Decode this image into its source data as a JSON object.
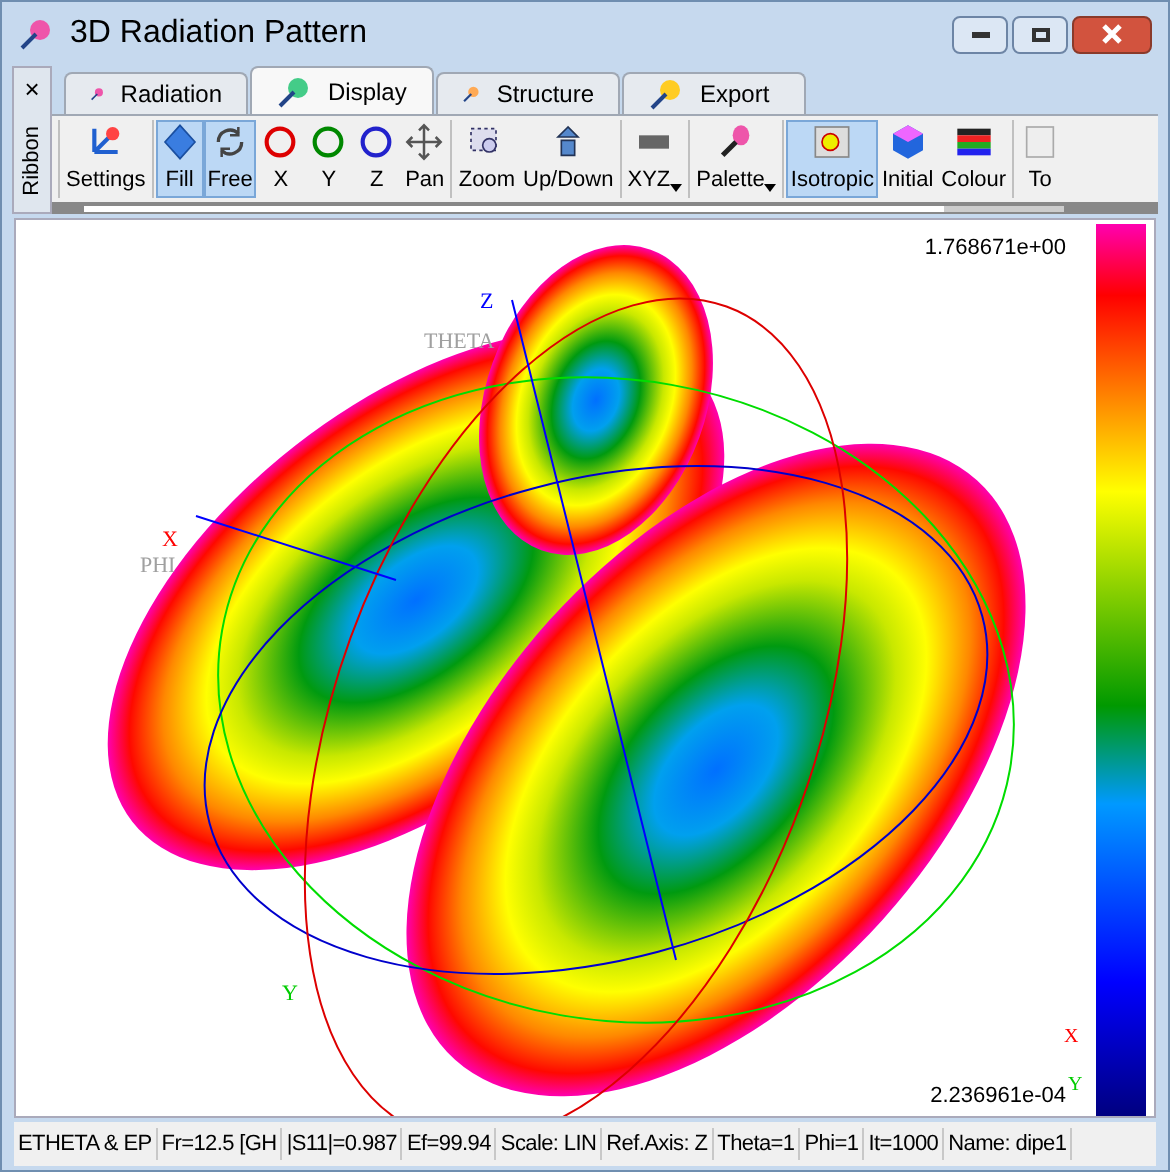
{
  "window": {
    "title": "3D Radiation Pattern"
  },
  "ribbon": {
    "close": "×",
    "label": "Ribbon"
  },
  "tabs": [
    {
      "label": "Radiation",
      "selected": false
    },
    {
      "label": "Display",
      "selected": true
    },
    {
      "label": "Structure",
      "selected": false
    },
    {
      "label": "Export",
      "selected": false
    }
  ],
  "toolbar": [
    [
      {
        "label": "Settings",
        "selected": false,
        "dropdown": false
      }
    ],
    [
      {
        "label": "Fill",
        "selected": true,
        "dropdown": false
      },
      {
        "label": "Free",
        "selected": true,
        "dropdown": false
      },
      {
        "label": "X",
        "selected": false,
        "dropdown": false
      },
      {
        "label": "Y",
        "selected": false,
        "dropdown": false
      },
      {
        "label": "Z",
        "selected": false,
        "dropdown": false
      },
      {
        "label": "Pan",
        "selected": false,
        "dropdown": false
      }
    ],
    [
      {
        "label": "Zoom",
        "selected": false,
        "dropdown": false
      },
      {
        "label": "Up/Down",
        "selected": false,
        "dropdown": false
      }
    ],
    [
      {
        "label": "XYZ",
        "selected": false,
        "dropdown": true
      }
    ],
    [
      {
        "label": "Palette",
        "selected": false,
        "dropdown": true
      }
    ],
    [
      {
        "label": "Isotropic",
        "selected": true,
        "dropdown": false
      },
      {
        "label": "Initial",
        "selected": false,
        "dropdown": false
      },
      {
        "label": "Colour",
        "selected": false,
        "dropdown": false
      }
    ],
    [
      {
        "label": "To",
        "selected": false,
        "dropdown": false
      }
    ]
  ],
  "plot": {
    "axes": [
      {
        "label": "Z",
        "color": "#0000ff"
      },
      {
        "label": "THETA",
        "color": "#a0a0a0"
      },
      {
        "label": "X",
        "color": "#ff0000"
      },
      {
        "label": "PHI",
        "color": "#a0a0a0"
      },
      {
        "label": "Y",
        "color": "#00cc00"
      }
    ],
    "triad": [
      {
        "label": "X",
        "color": "#ff0000"
      },
      {
        "label": "Y",
        "color": "#00cc00"
      }
    ],
    "colorbar": {
      "max": "1.768671e+00",
      "min": "2.236961e-04"
    }
  },
  "status_bar": [
    "ETHETA & EP",
    "Fr=12.5 [GH",
    "|S11|=0.987",
    "Ef=99.94",
    "Scale: LIN",
    "Ref.Axis: Z",
    "Theta=1",
    "Phi=1",
    "It=1000",
    "Name: dipe1"
  ]
}
